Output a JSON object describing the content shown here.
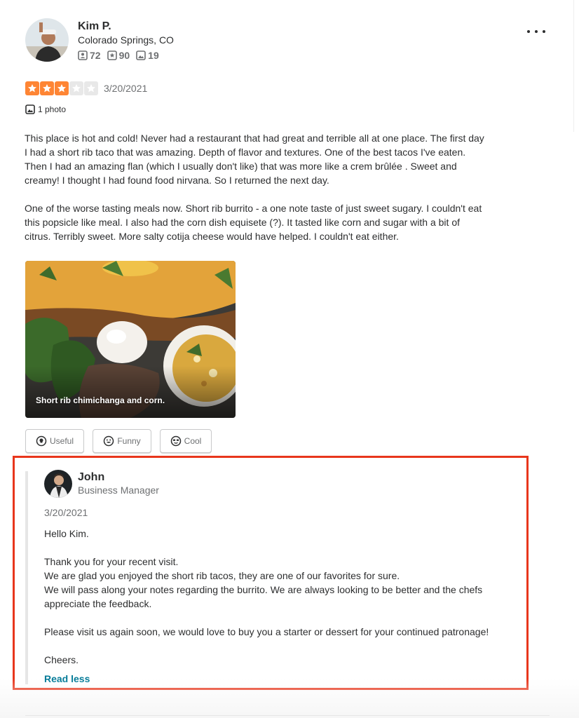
{
  "reviewer": {
    "name": "Kim P.",
    "location": "Colorado Springs, CO",
    "friends": "72",
    "reviews": "90",
    "photos": "19",
    "friends_icon": "friends-icon",
    "reviews_icon": "star-outline-icon",
    "photos_icon": "photo-icon"
  },
  "review": {
    "rating": 3,
    "max_rating": 5,
    "date": "3/20/2021",
    "photo_count_label": "1 photo",
    "paragraphs": [
      "This place is hot and cold! Never had a restaurant that had great and terrible all at one place. The first day I had a short rib taco that was amazing. Depth of flavor and textures. One of the best tacos I've eaten. Then I had an amazing flan (which I usually don't like) that was more like a crem brûlée . Sweet and creamy! I thought I had found food nirvana. So I returned the next day.",
      "One of the worse tasting meals now. Short rib burrito - a one note taste of just sweet sugary. I couldn't eat this popsicle like meal. I also had the corn dish equisete (?). It tasted like corn and sugar with a bit of citrus. Terribly sweet. More salty cotija cheese would have helped. I couldn't eat either."
    ],
    "photo_caption": "Short rib chimichanga and corn."
  },
  "reactions": {
    "useful": "Useful",
    "funny": "Funny",
    "cool": "Cool"
  },
  "owner_reply": {
    "name": "John",
    "title": "Business Manager",
    "date": "3/20/2021",
    "paragraphs": [
      "Hello Kim.",
      "Thank you for your recent visit.\nWe are glad you enjoyed the short rib tacos, they are one of our favorites for sure.\nWe will pass along your notes regarding the burrito.  We are always looking to be better and the chefs appreciate the feedback.",
      "Please visit us again soon, we would love to buy you a starter or dessert for your continued patronage!",
      "Cheers."
    ],
    "read_less_label": "Read less"
  },
  "colors": {
    "star": "#fe8534",
    "star_empty": "#e8e8e8",
    "link": "#027a97",
    "highlight_border": "#e8361c"
  }
}
